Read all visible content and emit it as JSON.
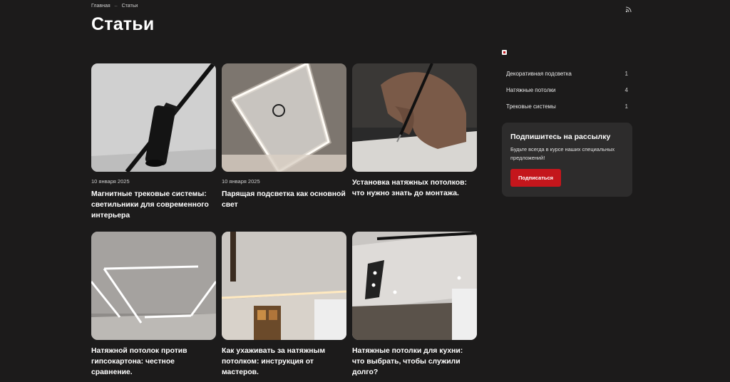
{
  "breadcrumb": {
    "home": "Главная",
    "sep": "–",
    "current": "Статьи"
  },
  "page_title": "Статьи",
  "articles": [
    {
      "date": "10 января 2025",
      "title": "Магнитные трековые системы: светильники для современного интерьера",
      "image": "track-light-photo"
    },
    {
      "date": "10 января 2025",
      "title": "Парящая подсветка как основной свет",
      "image": "floating-light-ceiling-photo"
    },
    {
      "date": "",
      "title": "Установка натяжных потолков: что нужно знать до монтажа.",
      "image": "hand-writing-photo"
    },
    {
      "date": "",
      "title": "Натяжной потолок против гипсокартона: честное сравнение.",
      "image": "light-lines-ceiling-photo"
    },
    {
      "date": "",
      "title": "Как ухаживать за натяжным потолком: инструкция от мастеров.",
      "image": "room-ceiling-photo"
    },
    {
      "date": "",
      "title": "Натяжные потолки для кухни: что выбрать, чтобы служили долго?",
      "image": "kitchen-ceiling-photo"
    }
  ],
  "sidebar": {
    "categories": [
      {
        "name": "Декоративная подсветка",
        "count": "1"
      },
      {
        "name": "Натяжные потолки",
        "count": "4"
      },
      {
        "name": "Трековые системы",
        "count": "1"
      }
    ],
    "subscribe": {
      "title": "Подпишитесь на рассылку",
      "text": "Будьте всегда в курсе наших специальных предложений!",
      "button": "Подписаться"
    }
  },
  "colors": {
    "background": "#1c1b1b",
    "accent": "#c4161c",
    "panel": "#2d2c2c"
  }
}
